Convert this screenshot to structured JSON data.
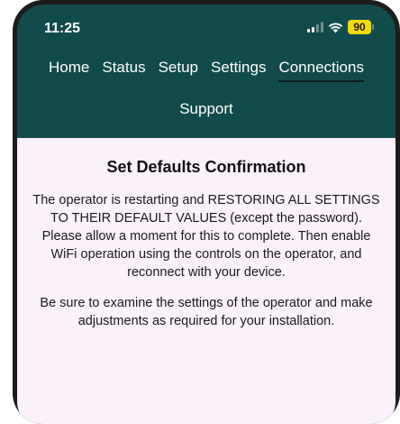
{
  "status_bar": {
    "time": "11:25",
    "battery": "90",
    "icons": [
      "signal-icon",
      "wifi-icon",
      "battery-icon"
    ]
  },
  "nav": {
    "items": [
      {
        "label": "Home"
      },
      {
        "label": "Status"
      },
      {
        "label": "Setup"
      },
      {
        "label": "Settings"
      },
      {
        "label": "Connections",
        "active": true
      },
      {
        "label": "Support"
      }
    ]
  },
  "content": {
    "title": "Set Defaults Confirmation",
    "paragraph1": "The operator is restarting and RESTORING ALL SETTINGS TO THEIR DEFAULT VALUES (except the password). Please allow a moment for this to complete. Then enable WiFi operation using the controls on the operator, and reconnect with your device.",
    "paragraph2": "Be sure to examine the settings of the operator and make adjustments as required for your installation."
  },
  "colors": {
    "header_bg": "#114b4b",
    "content_bg": "#fbf1fb",
    "battery": "#f5d90a"
  }
}
